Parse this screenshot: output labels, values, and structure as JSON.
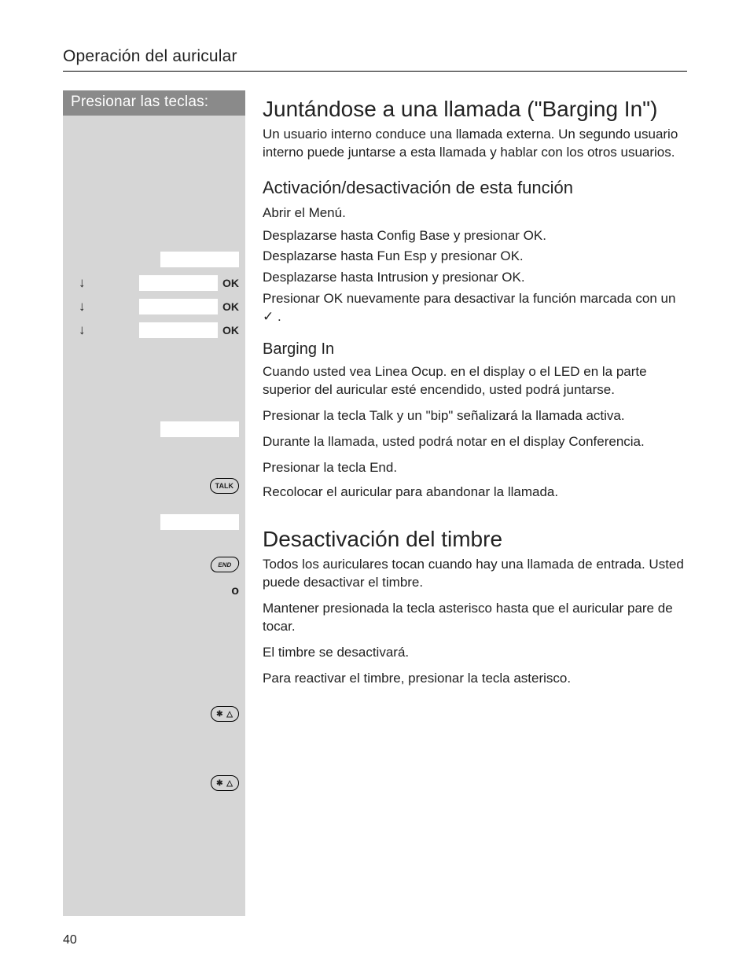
{
  "running_head": "Operación del auricular",
  "page_number": "40",
  "keycol_header": "Presionar las teclas:",
  "keys": {
    "menu_placeholder": "        ",
    "ok": "OK",
    "talk": "TALK",
    "end": "END",
    "o": "o",
    "star": "✱ △"
  },
  "h1_barging": "Juntándose a una llamada (\"Barging In\")",
  "p_barging_intro": "Un usuario interno conduce una llamada externa. Un segundo usuario interno puede juntarse a esta llamada y hablar con los otros usuarios.",
  "h2_activation": "Activación/desactivación de esta función",
  "p_open_menu": "Abrir el Menú.",
  "p_config_base": "Desplazarse hasta Config Base y presionar OK.",
  "p_fun_esp": "Desplazarse hasta Fun Esp y presionar OK.",
  "p_intrusion": "Desplazarse hasta Intrusion y presionar OK.",
  "p_press_ok_again": "Presionar OK nuevamente para desactivar la función marcada con un ✓ .",
  "h3_barging_in": "Barging In",
  "p_linea_ocup": "Cuando usted vea Linea Ocup. en el display o el LED en la parte superior del auricular esté encendido, usted podrá juntarse.",
  "p_press_talk": "Presionar la tecla Talk y un \"bip\" señalizará la llamada activa.",
  "p_during_call": "Durante la llamada, usted podrá notar en el display Conferencia.",
  "p_press_end": "Presionar la tecla End.",
  "p_replace": "Recolocar el auricular para abandonar la llamada.",
  "h1_ringer_off": "Desactivación del timbre",
  "p_ringer_intro": "Todos los auriculares tocan cuando hay una llamada de entrada. Usted puede desactivar el timbre.",
  "p_hold_star": "Mantener presionada la tecla asterisco hasta que el auricular pare de tocar.",
  "p_ringer_off": "El timbre se desactivará.",
  "p_star_reactivate": "Para reactivar el timbre, presionar la tecla asterisco."
}
